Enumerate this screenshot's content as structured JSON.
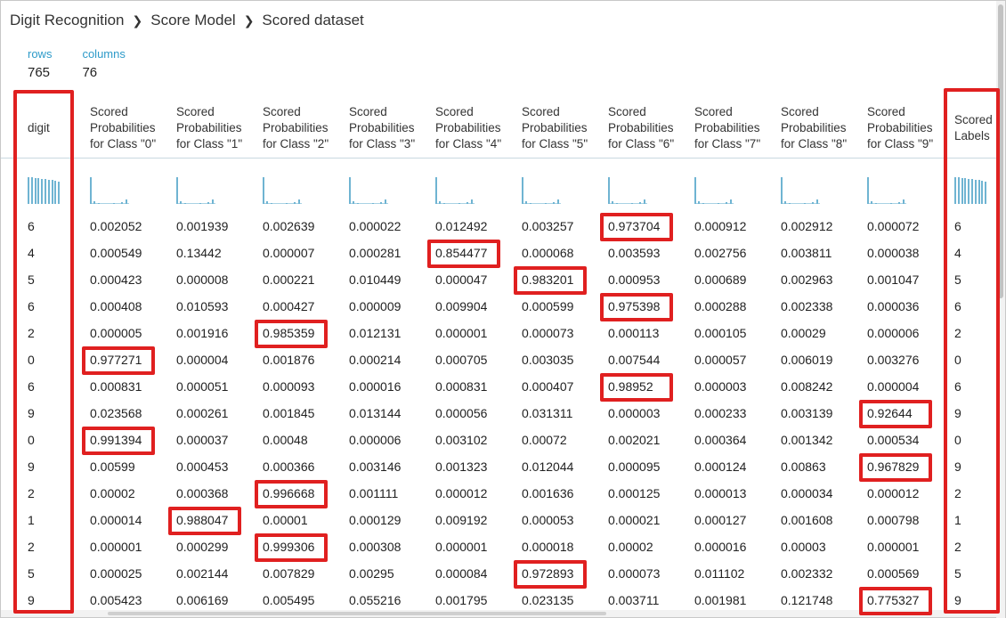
{
  "breadcrumb": {
    "items": [
      "Digit Recognition",
      "Score Model",
      "Scored dataset"
    ],
    "separator": "❯"
  },
  "stats": {
    "rows_label": "rows",
    "rows_value": "765",
    "columns_label": "columns",
    "columns_value": "76"
  },
  "table": {
    "columns": [
      "digit",
      "Scored Probabilities for Class \"0\"",
      "Scored Probabilities for Class \"1\"",
      "Scored Probabilities for Class \"2\"",
      "Scored Probabilities for Class \"3\"",
      "Scored Probabilities for Class \"4\"",
      "Scored Probabilities for Class \"5\"",
      "Scored Probabilities for Class \"6\"",
      "Scored Probabilities for Class \"7\"",
      "Scored Probabilities for Class \"8\"",
      "Scored Probabilities for Class \"9\"",
      "Scored Labels"
    ],
    "rows": [
      [
        "6",
        "0.002052",
        "0.001939",
        "0.002639",
        "0.000022",
        "0.012492",
        "0.003257",
        "0.973704",
        "0.000912",
        "0.002912",
        "0.000072",
        "6"
      ],
      [
        "4",
        "0.000549",
        "0.13442",
        "0.000007",
        "0.000281",
        "0.854477",
        "0.000068",
        "0.003593",
        "0.002756",
        "0.003811",
        "0.000038",
        "4"
      ],
      [
        "5",
        "0.000423",
        "0.000008",
        "0.000221",
        "0.010449",
        "0.000047",
        "0.983201",
        "0.000953",
        "0.000689",
        "0.002963",
        "0.001047",
        "5"
      ],
      [
        "6",
        "0.000408",
        "0.010593",
        "0.000427",
        "0.000009",
        "0.009904",
        "0.000599",
        "0.975398",
        "0.000288",
        "0.002338",
        "0.000036",
        "6"
      ],
      [
        "2",
        "0.000005",
        "0.001916",
        "0.985359",
        "0.012131",
        "0.000001",
        "0.000073",
        "0.000113",
        "0.000105",
        "0.00029",
        "0.000006",
        "2"
      ],
      [
        "0",
        "0.977271",
        "0.000004",
        "0.001876",
        "0.000214",
        "0.000705",
        "0.003035",
        "0.007544",
        "0.000057",
        "0.006019",
        "0.003276",
        "0"
      ],
      [
        "6",
        "0.000831",
        "0.000051",
        "0.000093",
        "0.000016",
        "0.000831",
        "0.000407",
        "0.98952",
        "0.000003",
        "0.008242",
        "0.000004",
        "6"
      ],
      [
        "9",
        "0.023568",
        "0.000261",
        "0.001845",
        "0.013144",
        "0.000056",
        "0.031311",
        "0.000003",
        "0.000233",
        "0.003139",
        "0.92644",
        "9"
      ],
      [
        "0",
        "0.991394",
        "0.000037",
        "0.00048",
        "0.000006",
        "0.003102",
        "0.00072",
        "0.002021",
        "0.000364",
        "0.001342",
        "0.000534",
        "0"
      ],
      [
        "9",
        "0.00599",
        "0.000453",
        "0.000366",
        "0.003146",
        "0.001323",
        "0.012044",
        "0.000095",
        "0.000124",
        "0.00863",
        "0.967829",
        "9"
      ],
      [
        "2",
        "0.00002",
        "0.000368",
        "0.996668",
        "0.001111",
        "0.000012",
        "0.001636",
        "0.000125",
        "0.000013",
        "0.000034",
        "0.000012",
        "2"
      ],
      [
        "1",
        "0.000014",
        "0.988047",
        "0.00001",
        "0.000129",
        "0.009192",
        "0.000053",
        "0.000021",
        "0.000127",
        "0.001608",
        "0.000798",
        "1"
      ],
      [
        "2",
        "0.000001",
        "0.000299",
        "0.999306",
        "0.000308",
        "0.000001",
        "0.000018",
        "0.00002",
        "0.000016",
        "0.00003",
        "0.000001",
        "2"
      ],
      [
        "5",
        "0.000025",
        "0.002144",
        "0.007829",
        "0.00295",
        "0.000084",
        "0.972893",
        "0.000073",
        "0.011102",
        "0.002332",
        "0.000569",
        "5"
      ],
      [
        "9",
        "0.005423",
        "0.006169",
        "0.005495",
        "0.055216",
        "0.001795",
        "0.023135",
        "0.003711",
        "0.001981",
        "0.121748",
        "0.775327",
        "9"
      ]
    ]
  },
  "colors": {
    "accent": "#2e9bc9",
    "histogram": "#6fb4d2",
    "highlight": "#e02020"
  }
}
